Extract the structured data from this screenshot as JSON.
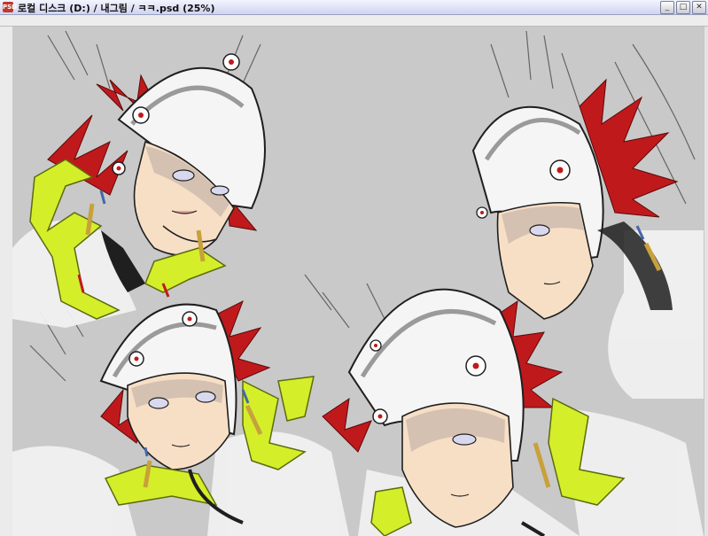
{
  "window": {
    "app_icon": "PSD",
    "title": "로컬 디스크 (D:) / 내그림 / ㅋㅋ.psd (25%)",
    "buttons": [
      "_",
      "□",
      "✕"
    ]
  },
  "colors": {
    "canvas_bg": "#c9c9c9",
    "hair_red": "#c0191c",
    "strap_lime": "#d5ee2a",
    "helmet_white": "#f2f2f2",
    "skin": "#f7dfc6",
    "line": "#1f1f1f"
  }
}
